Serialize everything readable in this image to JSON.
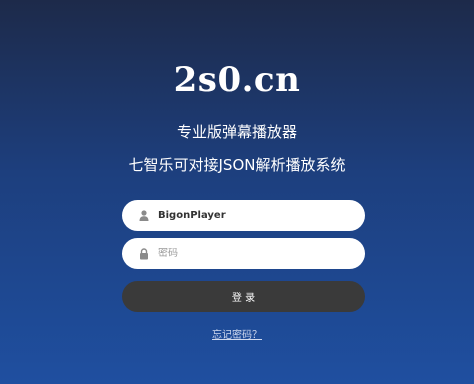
{
  "brand": {
    "logo": "2s0.cn",
    "subtitle_1": "专业版弹幕播放器",
    "subtitle_2": "七智乐可对接JSON解析播放系统"
  },
  "form": {
    "username_value": "BigonPlayer",
    "username_icon": "user-icon",
    "password_placeholder": "密码",
    "password_icon": "lock-icon",
    "login_label": "登 录",
    "forgot_label": "忘记密码？"
  },
  "colors": {
    "background_top": "#1d2a4a",
    "background_bottom": "#1f4fa0",
    "button": "#3a3a3a",
    "field": "#ffffff"
  }
}
